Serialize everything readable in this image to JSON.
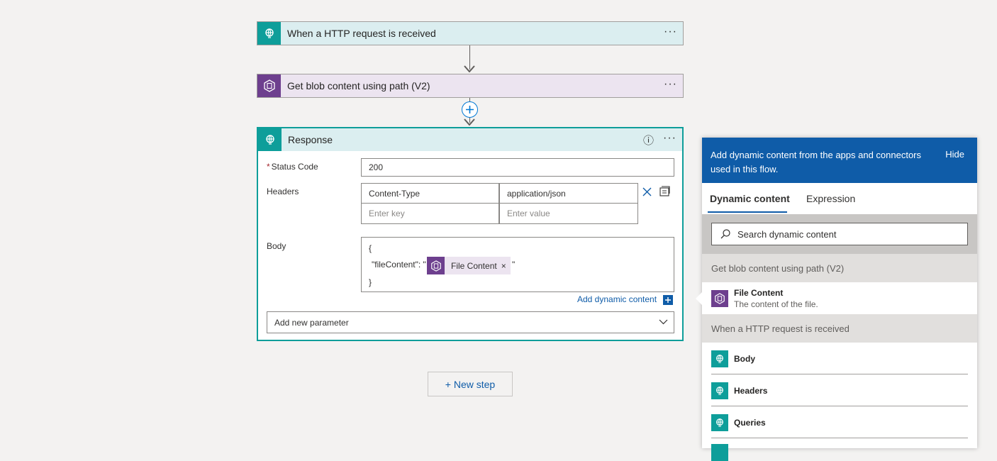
{
  "trigger": {
    "title": "When a HTTP request is received",
    "more": "···"
  },
  "blob_action": {
    "title": "Get blob content using path (V2)",
    "more": "···"
  },
  "response": {
    "title": "Response",
    "info": "ⓘ",
    "more": "···",
    "status_label": "Status Code",
    "status_value": "200",
    "headers_label": "Headers",
    "header_key": "Content-Type",
    "header_value": "application/json",
    "key_placeholder": "Enter key",
    "value_placeholder": "Enter value",
    "body_label": "Body",
    "body_line1": "{",
    "body_line2_prefix": "\"fileContent\": \"",
    "body_line2_suffix": "\"",
    "body_line3": "}",
    "token_label": "File Content",
    "token_remove": "×",
    "add_dynamic": "Add dynamic content",
    "add_param": "Add new parameter"
  },
  "new_step": "+ New step",
  "panel": {
    "header_text": "Add dynamic content from the apps and connectors used in this flow.",
    "hide": "Hide",
    "tab_dynamic": "Dynamic content",
    "tab_expression": "Expression",
    "search_placeholder": "Search dynamic content",
    "section_blob": "Get blob content using path (V2)",
    "file_content_title": "File Content",
    "file_content_desc": "The content of the file.",
    "section_http": "When a HTTP request is received",
    "http_items": [
      "Body",
      "Headers",
      "Queries"
    ]
  },
  "colors": {
    "teal": "#0e9e9a",
    "purple": "#6d3f8e",
    "blue": "#0f5ca8"
  }
}
